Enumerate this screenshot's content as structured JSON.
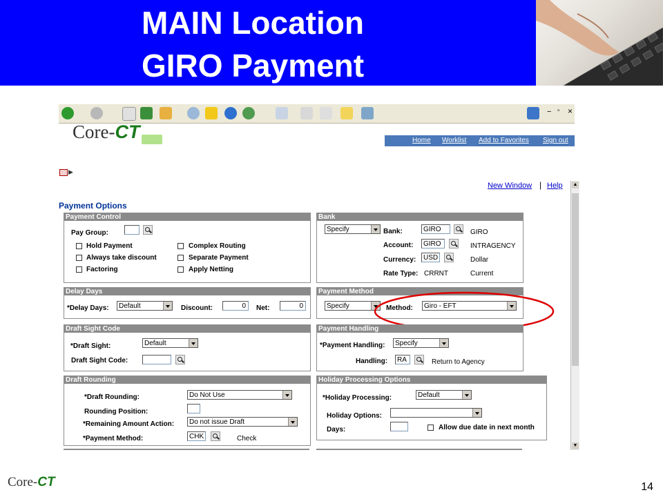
{
  "slide": {
    "title_line1": "MAIN Location",
    "title_line2": "GIRO Payment",
    "page_number": "14",
    "footer_logo_left": "Core-",
    "footer_logo_right": "CT"
  },
  "browser": {
    "logo_left": "Core-",
    "logo_right": "CT",
    "nav_links": [
      "Home",
      "Worklist",
      "Add to Favorites",
      "Sign out"
    ]
  },
  "page": {
    "new_window": "New Window",
    "separator": "|",
    "help": "Help",
    "title": "Payment Options"
  },
  "payment_control": {
    "header": "Payment Control",
    "pay_group_label": "Pay Group:",
    "pay_group_value": "",
    "hold_payment": "Hold Payment",
    "always_take_discount": "Always take discount",
    "factoring": "Factoring",
    "complex_routing": "Complex Routing",
    "separate_payment": "Separate Payment",
    "apply_netting": "Apply Netting"
  },
  "bank": {
    "header": "Bank",
    "source": "Specify",
    "bank_label": "Bank:",
    "bank_value": "GIRO",
    "bank_desc": "GIRO",
    "account_label": "Account:",
    "account_value": "GIRO",
    "account_desc": "INTRAGENCY",
    "currency_label": "Currency:",
    "currency_value": "USD",
    "currency_desc": "Dollar",
    "rate_type_label": "Rate Type:",
    "rate_type_value": "CRRNT",
    "rate_type_desc": "Current"
  },
  "delay_days": {
    "header": "Delay Days",
    "label": "*Delay Days:",
    "value": "Default",
    "discount_label": "Discount:",
    "discount_value": "0",
    "net_label": "Net:",
    "net_value": "0"
  },
  "payment_method": {
    "header": "Payment Method",
    "source": "Specify",
    "method_label": "Method:",
    "method_value": "Giro - EFT"
  },
  "draft_sight": {
    "header": "Draft Sight Code",
    "sight_label": "*Draft Sight:",
    "sight_value": "Default",
    "code_label": "Draft Sight Code:",
    "code_value": ""
  },
  "payment_handling": {
    "header": "Payment Handling",
    "handling_label": "*Payment Handling:",
    "handling_source": "Specify",
    "handling_code_label": "Handling:",
    "handling_code_value": "RA",
    "handling_desc": "Return to Agency"
  },
  "draft_rounding": {
    "header": "Draft Rounding",
    "rounding_label": "*Draft Rounding:",
    "rounding_value": "Do Not Use",
    "position_label": "Rounding Position:",
    "position_value": "",
    "remaining_label": "*Remaining Amount Action:",
    "remaining_value": "Do not issue Draft",
    "method_label": "*Payment Method:",
    "method_value": "CHK",
    "method_desc": "Check"
  },
  "holiday": {
    "header": "Holiday Processing Options",
    "processing_label": "*Holiday Processing:",
    "processing_value": "Default",
    "options_label": "Holiday Options:",
    "options_value": "",
    "days_label": "Days:",
    "days_value": "",
    "allow_due_date": "Allow due date in next month"
  },
  "colors": {
    "banner": "#0000ff",
    "highlight_ellipse": "#dd0000",
    "section_header": "#8a8a8a",
    "nav_strip": "#4a78b8"
  }
}
